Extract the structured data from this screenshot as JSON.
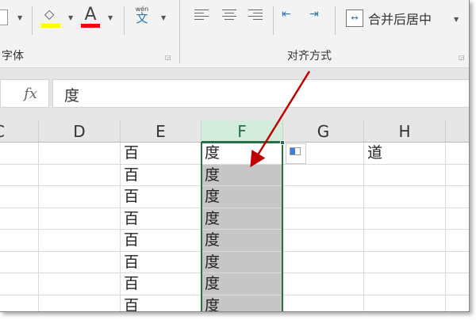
{
  "ribbon": {
    "font_group": {
      "label": "字体",
      "fill_color": "#ffff00",
      "font_color": "#ff0000",
      "font_color_glyph": "A",
      "phonetic_top": "wén",
      "phonetic_char": "文"
    },
    "align_group": {
      "label": "对齐方式",
      "merge_label": "合并后居中"
    }
  },
  "formula_bar": {
    "fx_label": "fx",
    "value": "度"
  },
  "columns": [
    "C",
    "D",
    "E",
    "F",
    "G",
    "H"
  ],
  "selected_column": "F",
  "rows": [
    {
      "E": "百",
      "F": "度",
      "H": "道"
    },
    {
      "E": "百",
      "F": "度"
    },
    {
      "E": "百",
      "F": "度"
    },
    {
      "E": "百",
      "F": "度"
    },
    {
      "E": "百",
      "F": "度"
    },
    {
      "E": "百",
      "F": "度"
    },
    {
      "E": "百",
      "F": "度"
    },
    {
      "E": "百",
      "F": "度"
    }
  ],
  "annotation": {
    "arrow_color": "#c00000"
  }
}
